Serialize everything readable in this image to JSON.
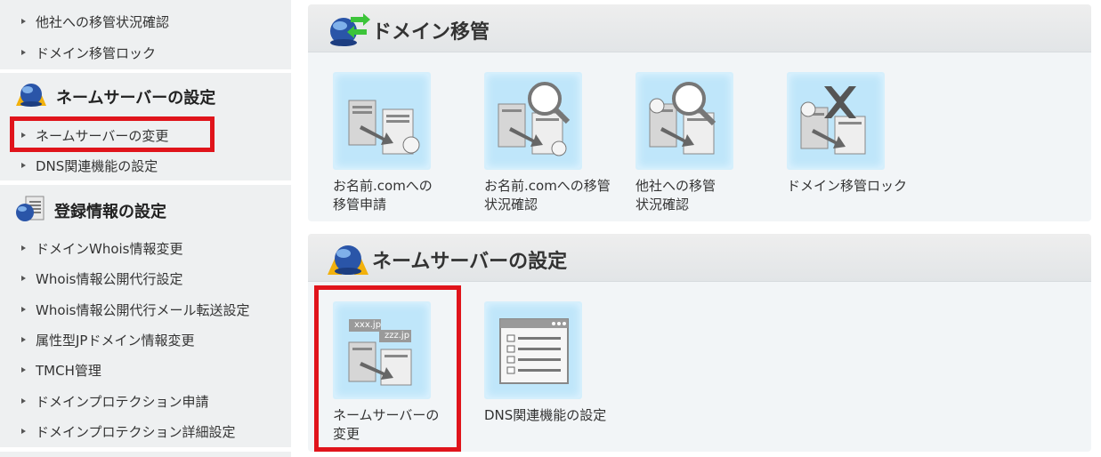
{
  "sidebar": {
    "top_items": [
      {
        "label": "他社への移管状況確認"
      },
      {
        "label": "ドメイン移管ロック"
      }
    ],
    "nameserver_section": {
      "title": "ネームサーバーの設定",
      "icon": "globe-arrows-icon",
      "items": [
        {
          "label": "ネームサーバーの変更"
        },
        {
          "label": "DNS関連機能の設定"
        }
      ]
    },
    "registration_section": {
      "title": "登録情報の設定",
      "icon": "document-globe-icon",
      "items": [
        {
          "label": "ドメインWhois情報変更"
        },
        {
          "label": "Whois情報公開代行設定"
        },
        {
          "label": "Whois情報公開代行メール転送設定"
        },
        {
          "label": "属性型JPドメイン情報変更"
        },
        {
          "label": "TMCH管理"
        },
        {
          "label": "ドメインプロテクション申請"
        },
        {
          "label": "ドメインプロテクション詳細設定"
        }
      ]
    }
  },
  "main": {
    "transfer_panel": {
      "title": "ドメイン移管",
      "icon": "globe-transfer-icon",
      "tiles": [
        {
          "label": "お名前.comへの\n移管申請",
          "icon": "server-transfer-icon"
        },
        {
          "label": "お名前.comへの移管\n状況確認",
          "icon": "magnifier-server-icon"
        },
        {
          "label": "他社への移管\n状況確認",
          "icon": "magnifier-server-icon"
        },
        {
          "label": "ドメイン移管ロック",
          "icon": "lock-x-server-icon"
        }
      ]
    },
    "nameserver_panel": {
      "title": "ネームサーバーの設定",
      "icon": "globe-arrows-icon",
      "tiles": [
        {
          "label": "ネームサーバーの\n変更",
          "icon": "nameserver-change-icon",
          "badge_1": "xxx.jp",
          "badge_2": "zzz.jp"
        },
        {
          "label": "DNS関連機能の設定",
          "icon": "dns-settings-window-icon"
        }
      ]
    }
  },
  "colors": {
    "highlight": "#e0141b",
    "tile_bg": "#bfe6fa",
    "panel_bg": "#f2f5f7",
    "sidebar_bg": "#eef0f1"
  }
}
